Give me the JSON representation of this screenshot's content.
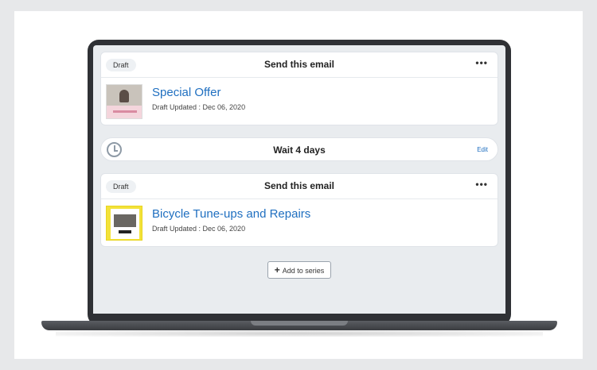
{
  "steps": [
    {
      "badge": "Draft",
      "action": "Send this email",
      "menu_icon": "more-horizontal-icon",
      "more_glyph": "•••",
      "title": "Special Offer",
      "subtitle": "Draft Updated : Dec 06, 2020"
    },
    {
      "badge": "Draft",
      "action": "Send this email",
      "menu_icon": "more-horizontal-icon",
      "more_glyph": "•••",
      "title": "Bicycle Tune-ups and Repairs",
      "subtitle": "Draft Updated : Dec 06, 2020"
    }
  ],
  "wait": {
    "icon": "clock-icon",
    "label": "Wait 4 days",
    "edit_label": "Edit"
  },
  "add_button": {
    "icon": "plus-icon",
    "plus_glyph": "+",
    "label": "Add to series"
  },
  "colors": {
    "link": "#1f6fc0",
    "screen_bg": "#e9ecef",
    "thumb_yellow": "#f3e23a"
  }
}
